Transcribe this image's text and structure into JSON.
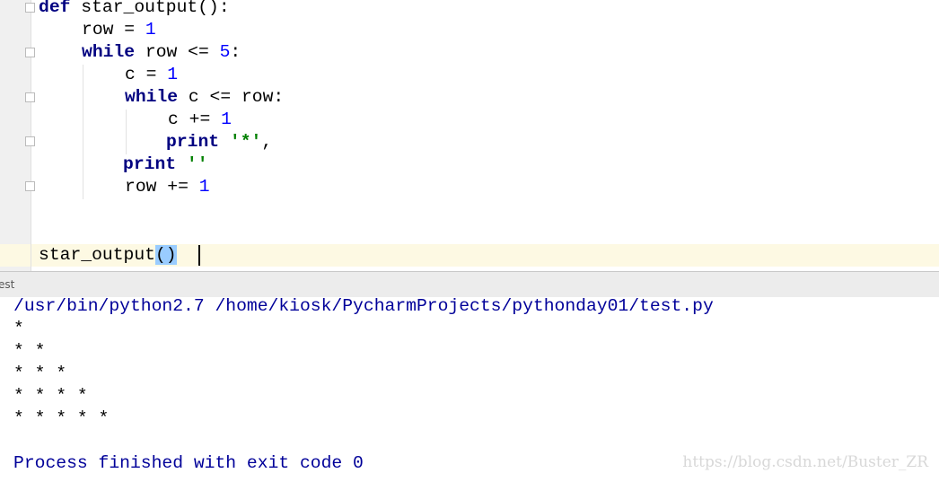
{
  "editor": {
    "lines": [
      {
        "kw": "def",
        "rest": " star_output():"
      },
      {
        "a": "row = ",
        "n": "1"
      },
      {
        "kw": "while",
        "a": " row <= ",
        "n": "5",
        "b": ":"
      },
      {
        "a": "c = ",
        "n": "1"
      },
      {
        "kw": "while",
        "a": " c <= row:"
      },
      {
        "a": "c += ",
        "n": "1"
      },
      {
        "kw": "print",
        "s": " '*'",
        "b": ","
      },
      {
        "kw": "print",
        "s": " ''"
      },
      {
        "a": "row += ",
        "n": "1"
      }
    ],
    "call_line": {
      "name": "star_output",
      "parens": "()"
    }
  },
  "run_tab": {
    "label": "est"
  },
  "console": {
    "command": "/usr/bin/python2.7 /home/kiosk/PycharmProjects/pythonday01/test.py",
    "output": [
      "*",
      "* *",
      "* * *",
      "* * * *",
      "* * * * *"
    ],
    "exit": "Process finished with exit code 0"
  },
  "watermark": "https://blog.csdn.net/Buster_ZR"
}
